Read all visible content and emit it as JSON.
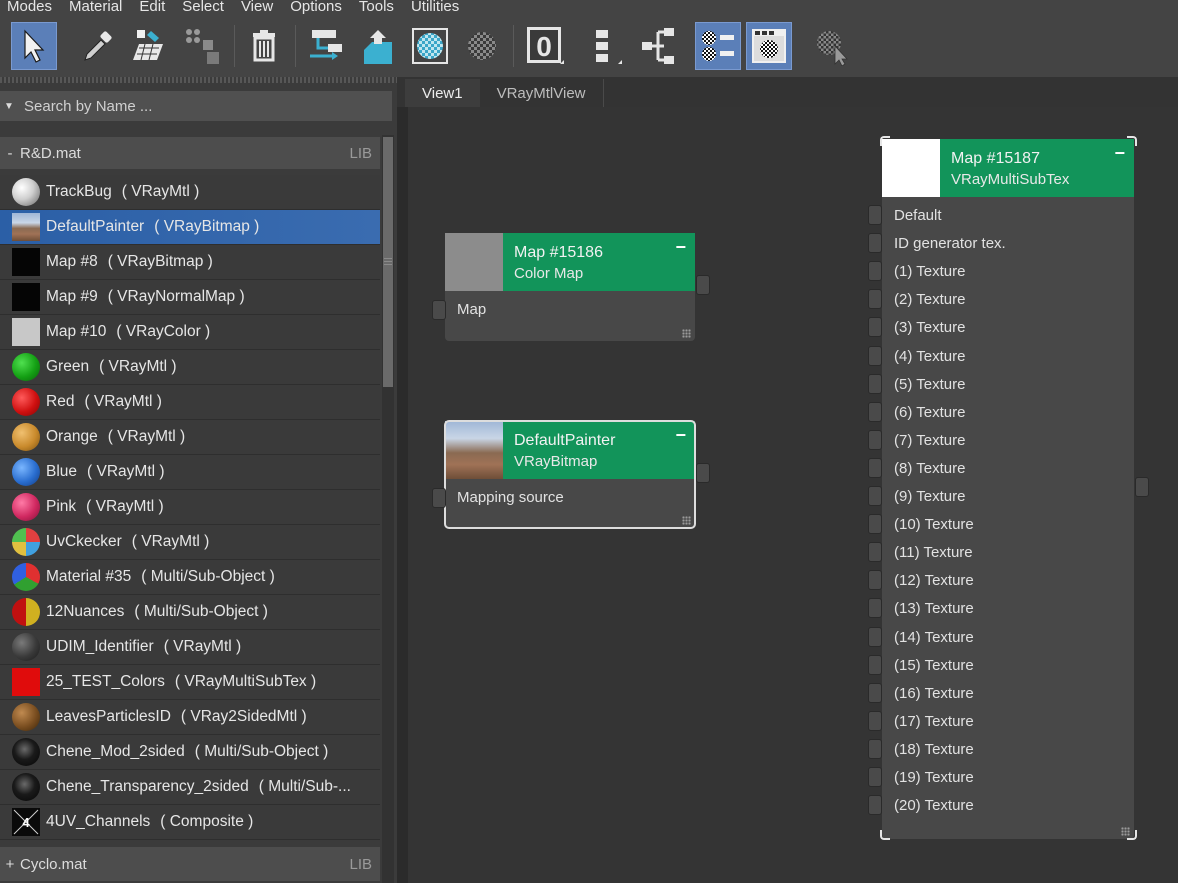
{
  "menu": [
    "Modes",
    "Material",
    "Edit",
    "Select",
    "View",
    "Options",
    "Tools",
    "Utilities"
  ],
  "toolbar": {
    "buttons": [
      {
        "icon": "select-arrow-icon",
        "active": true
      },
      {
        "icon": "eyedropper-icon",
        "active": false
      },
      {
        "icon": "assign-material-icon",
        "active": false
      },
      {
        "icon": "move-children-icon",
        "active": false
      },
      {
        "icon": "delete-icon",
        "active": false
      },
      {
        "icon": "layout-tree-icon",
        "active": false
      },
      {
        "icon": "put-to-library-icon",
        "active": false
      },
      {
        "icon": "preview-sphere-icon",
        "active": false
      },
      {
        "icon": "background-checker-icon",
        "active": false
      },
      {
        "icon": "material-id-icon",
        "active": false,
        "label": "0"
      },
      {
        "icon": "layout-children-icon",
        "active": false
      },
      {
        "icon": "layout-all-icon",
        "active": false
      },
      {
        "icon": "show-node-icon",
        "active": true
      },
      {
        "icon": "parameter-editor-icon",
        "active": true
      },
      {
        "icon": "select-by-material-icon",
        "active": false
      }
    ]
  },
  "search": {
    "placeholder": "Search by Name ..."
  },
  "libraries": [
    {
      "toggle": "-",
      "name": "R&D.mat",
      "tag": "LIB"
    },
    {
      "toggle": "+",
      "name": "Cyclo.mat",
      "tag": "LIB"
    }
  ],
  "materials": [
    {
      "name": "TrackBug",
      "type": "( VRayMtl )",
      "swatch": "sphere-white"
    },
    {
      "name": "DefaultPainter",
      "type": "( VRayBitmap )",
      "swatch": "landscape",
      "selected": true
    },
    {
      "name": "Map #8",
      "type": "( VRayBitmap )",
      "swatch": "black"
    },
    {
      "name": "Map #9",
      "type": "( VRayNormalMap )",
      "swatch": "black"
    },
    {
      "name": "Map #10",
      "type": "( VRayColor )",
      "swatch": "grey"
    },
    {
      "name": "Green",
      "type": "( VRayMtl )",
      "swatch": "sphere-green"
    },
    {
      "name": "Red",
      "type": "( VRayMtl )",
      "swatch": "sphere-red"
    },
    {
      "name": "Orange",
      "type": "( VRayMtl )",
      "swatch": "sphere-orange"
    },
    {
      "name": "Blue",
      "type": "( VRayMtl )",
      "swatch": "sphere-blue"
    },
    {
      "name": "Pink",
      "type": "( VRayMtl )",
      "swatch": "sphere-pink"
    },
    {
      "name": "UvCkecker",
      "type": "( VRayMtl )",
      "swatch": "sphere-checker"
    },
    {
      "name": "Material #35",
      "type": "( Multi/Sub-Object )",
      "swatch": "sphere-multi"
    },
    {
      "name": "12Nuances",
      "type": "( Multi/Sub-Object )",
      "swatch": "sphere-nuances"
    },
    {
      "name": "UDIM_Identifier",
      "type": "( VRayMtl )",
      "swatch": "sphere-dark"
    },
    {
      "name": "25_TEST_Colors",
      "type": "( VRayMultiSubTex )",
      "swatch": "red-square"
    },
    {
      "name": "LeavesParticlesID",
      "type": "( VRay2SidedMtl )",
      "swatch": "sphere-brown"
    },
    {
      "name": "Chene_Mod_2sided",
      "type": "( Multi/Sub-Object )",
      "swatch": "sphere-black"
    },
    {
      "name": "Chene_Transparency_2sided",
      "type": "( Multi/Sub-...",
      "swatch": "sphere-black"
    },
    {
      "name": "4UV_Channels",
      "type": "( Composite )",
      "swatch": "uv4"
    }
  ],
  "tabs": [
    {
      "label": "View1",
      "active": true
    },
    {
      "label": "VRayMtlView",
      "active": false
    }
  ],
  "nodes": {
    "color_map": {
      "title": "Map #15186",
      "subtitle": "Color Map",
      "slots": [
        "Map"
      ],
      "min": "−"
    },
    "bitmap": {
      "title": "DefaultPainter",
      "subtitle": "VRayBitmap",
      "slots": [
        "Mapping source"
      ],
      "min": "−"
    },
    "multisub": {
      "title": "Map #15187",
      "subtitle": "VRayMultiSubTex",
      "min": "−",
      "slots": [
        "Default",
        "ID generator tex.",
        "(1) Texture",
        "(2) Texture",
        "(3) Texture",
        "(4) Texture",
        "(5) Texture",
        "(6) Texture",
        "(7) Texture",
        "(8) Texture",
        "(9) Texture",
        "(10) Texture",
        "(11) Texture",
        "(12) Texture",
        "(13) Texture",
        "(14) Texture",
        "(15) Texture",
        "(16) Texture",
        "(17) Texture",
        "(18) Texture",
        "(19) Texture",
        "(20) Texture"
      ]
    }
  },
  "colors": {
    "node_header": "#12945a",
    "selection": "#2b5fa6",
    "active_button": "#5b7fb8"
  }
}
